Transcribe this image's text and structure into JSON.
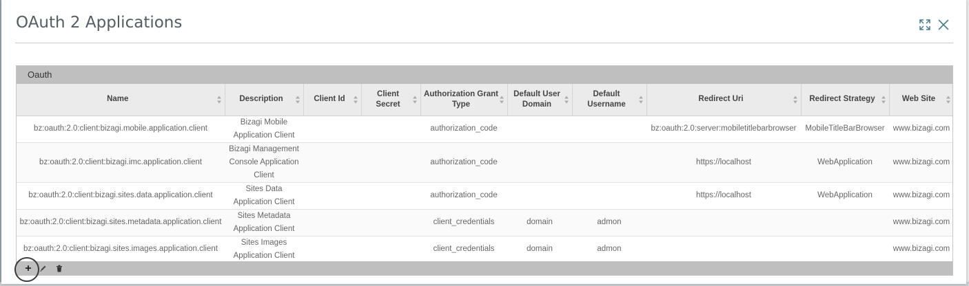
{
  "dialog": {
    "title": "OAuth 2 Applications",
    "expand_icon": "expand-icon",
    "close_icon": "close-icon"
  },
  "grid": {
    "caption": "Oauth",
    "columns": [
      "Name",
      "Description",
      "Client Id",
      "Client Secret",
      "Authorization Grant Type",
      "Default User Domain",
      "Default Username",
      "Redirect Uri",
      "Redirect Strategy",
      "Web Site"
    ],
    "rows": [
      {
        "name": "bz:oauth:2.0:client:bizagi.mobile.application.client",
        "description": "Bizagi Mobile Application Client",
        "client_id": "",
        "client_secret": "",
        "grant_type": "authorization_code",
        "user_domain": "",
        "username": "",
        "redirect_uri": "bz:oauth:2.0:server:mobiletitlebarbrowser",
        "redirect_strategy": "MobileTitleBarBrowser",
        "web_site": "www.bizagi.com"
      },
      {
        "name": "bz:oauth:2.0:client:bizagi.imc.application.client",
        "description": "Bizagi Management Console Application Client",
        "client_id": "",
        "client_secret": "",
        "grant_type": "authorization_code",
        "user_domain": "",
        "username": "",
        "redirect_uri": "https://localhost",
        "redirect_strategy": "WebApplication",
        "web_site": "www.bizagi.com"
      },
      {
        "name": "bz:oauth:2.0:client:bizagi.sites.data.application.client",
        "description": "Sites Data Application Client",
        "client_id": "",
        "client_secret": "",
        "grant_type": "authorization_code",
        "user_domain": "",
        "username": "",
        "redirect_uri": "https://localhost",
        "redirect_strategy": "WebApplication",
        "web_site": "www.bizagi.com"
      },
      {
        "name": "bz:oauth:2.0:client:bizagi.sites.metadata.application.client",
        "description": "Sites Metadata Application Client",
        "client_id": "",
        "client_secret": "",
        "grant_type": "client_credentials",
        "user_domain": "domain",
        "username": "admon",
        "redirect_uri": "",
        "redirect_strategy": "",
        "web_site": "www.bizagi.com"
      },
      {
        "name": "bz:oauth:2.0:client:bizagi.sites.images.application.client",
        "description": "Sites Images Application Client",
        "client_id": "",
        "client_secret": "",
        "grant_type": "client_credentials",
        "user_domain": "domain",
        "username": "admon",
        "redirect_uri": "",
        "redirect_strategy": "",
        "web_site": "www.bizagi.com"
      }
    ],
    "footer_icons": [
      "plus-icon",
      "pencil-icon",
      "trash-icon"
    ]
  },
  "colors": {
    "caption_bg": "#bfbfbf",
    "header_bg": "#ebebeb",
    "title_text": "#555c63",
    "icon": "#4a7c8c"
  }
}
